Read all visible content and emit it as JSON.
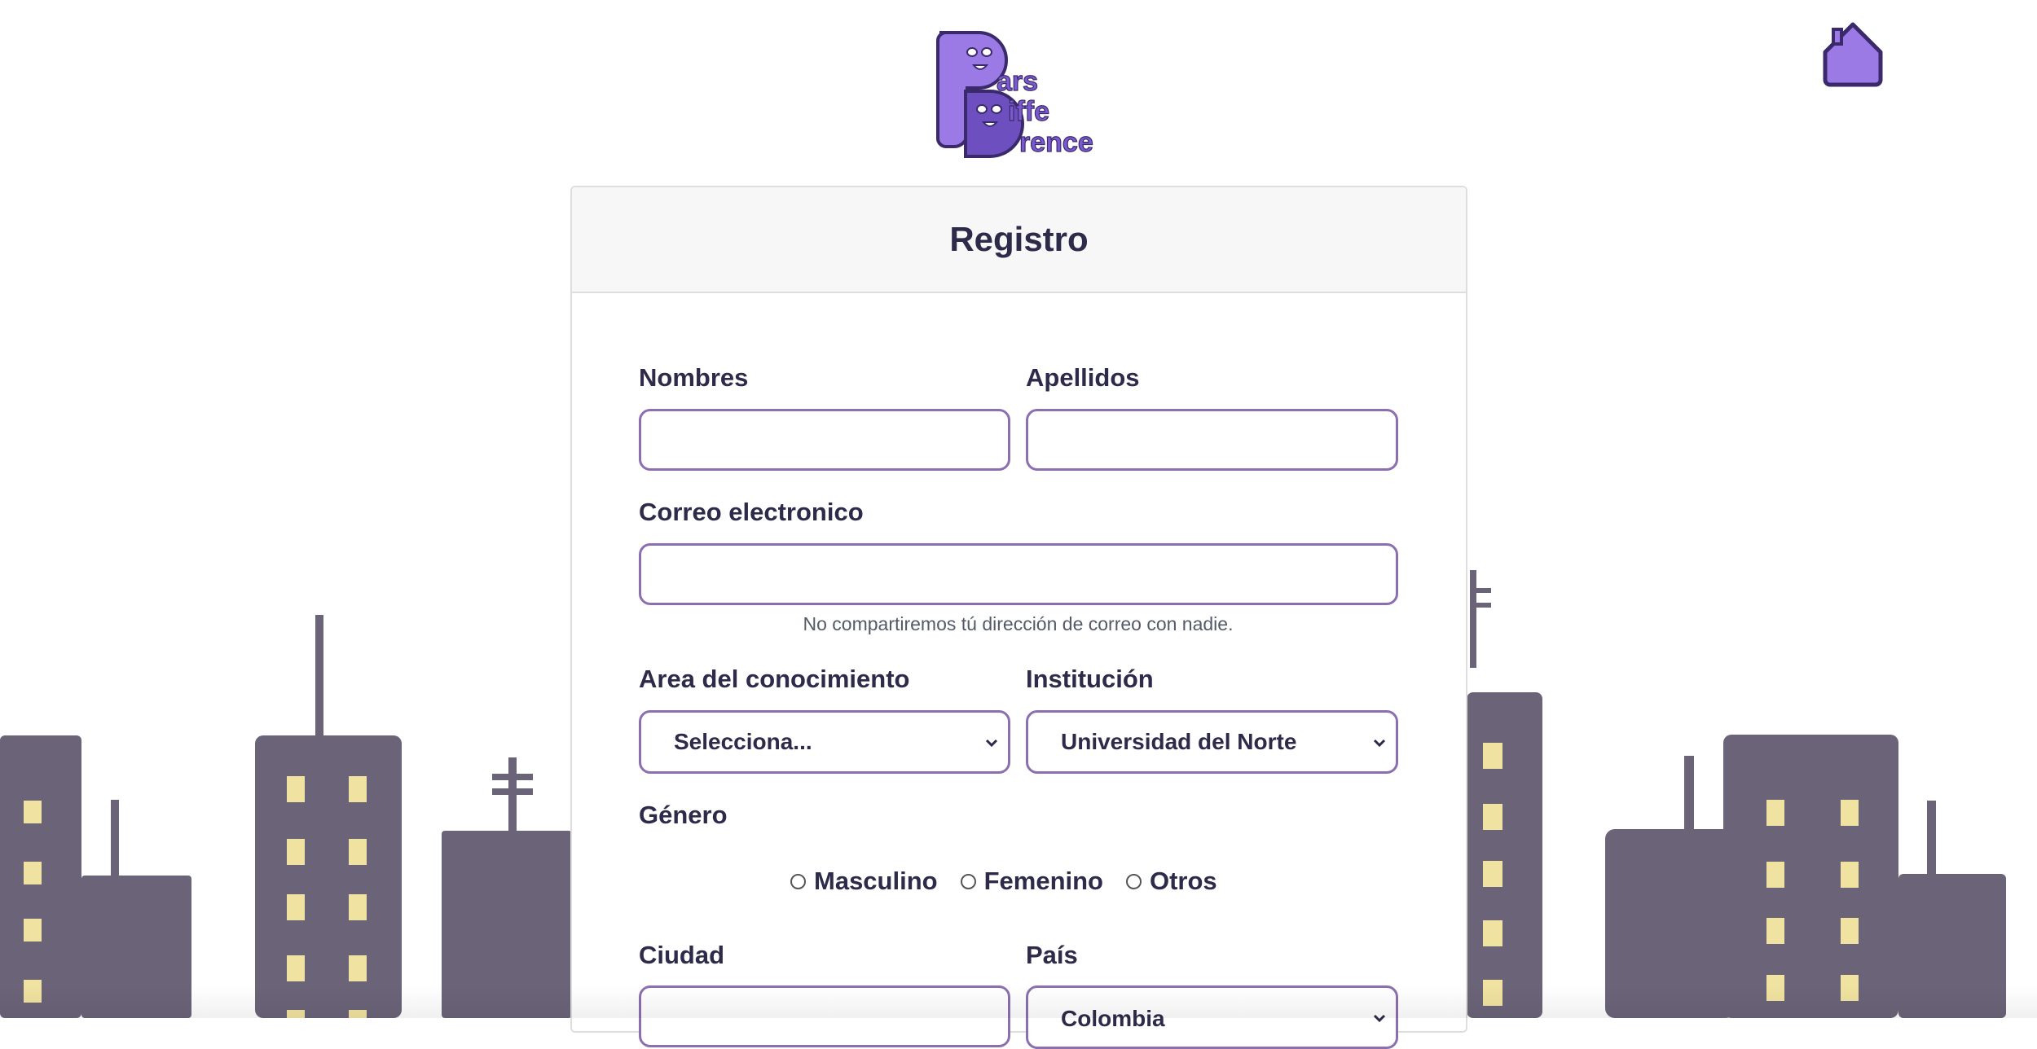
{
  "logo": {
    "line1": "ars",
    "line2": "iffe",
    "line3": "rence"
  },
  "header": {
    "title": "Registro"
  },
  "form": {
    "nombres_label": "Nombres",
    "apellidos_label": "Apellidos",
    "correo_label": "Correo electronico",
    "correo_help": "No compartiremos tú dirección de correo con nadie.",
    "area_label": "Area del conocimiento",
    "area_value": "Selecciona...",
    "institucion_label": "Institución",
    "institucion_value": "Universidad del Norte",
    "genero_label": "Género",
    "genero_options": [
      "Masculino",
      "Femenino",
      "Otros"
    ],
    "ciudad_label": "Ciudad",
    "pais_label": "País",
    "pais_value": "Colombia"
  },
  "colors": {
    "accent": "#8b6fb0",
    "logo_purple": "#9b7ae6",
    "text": "#2d2a4a",
    "building": "#6b6479",
    "window": "#f0e2a0"
  },
  "icons": {
    "home": "home-icon",
    "chevron": "chevron-down-icon"
  }
}
